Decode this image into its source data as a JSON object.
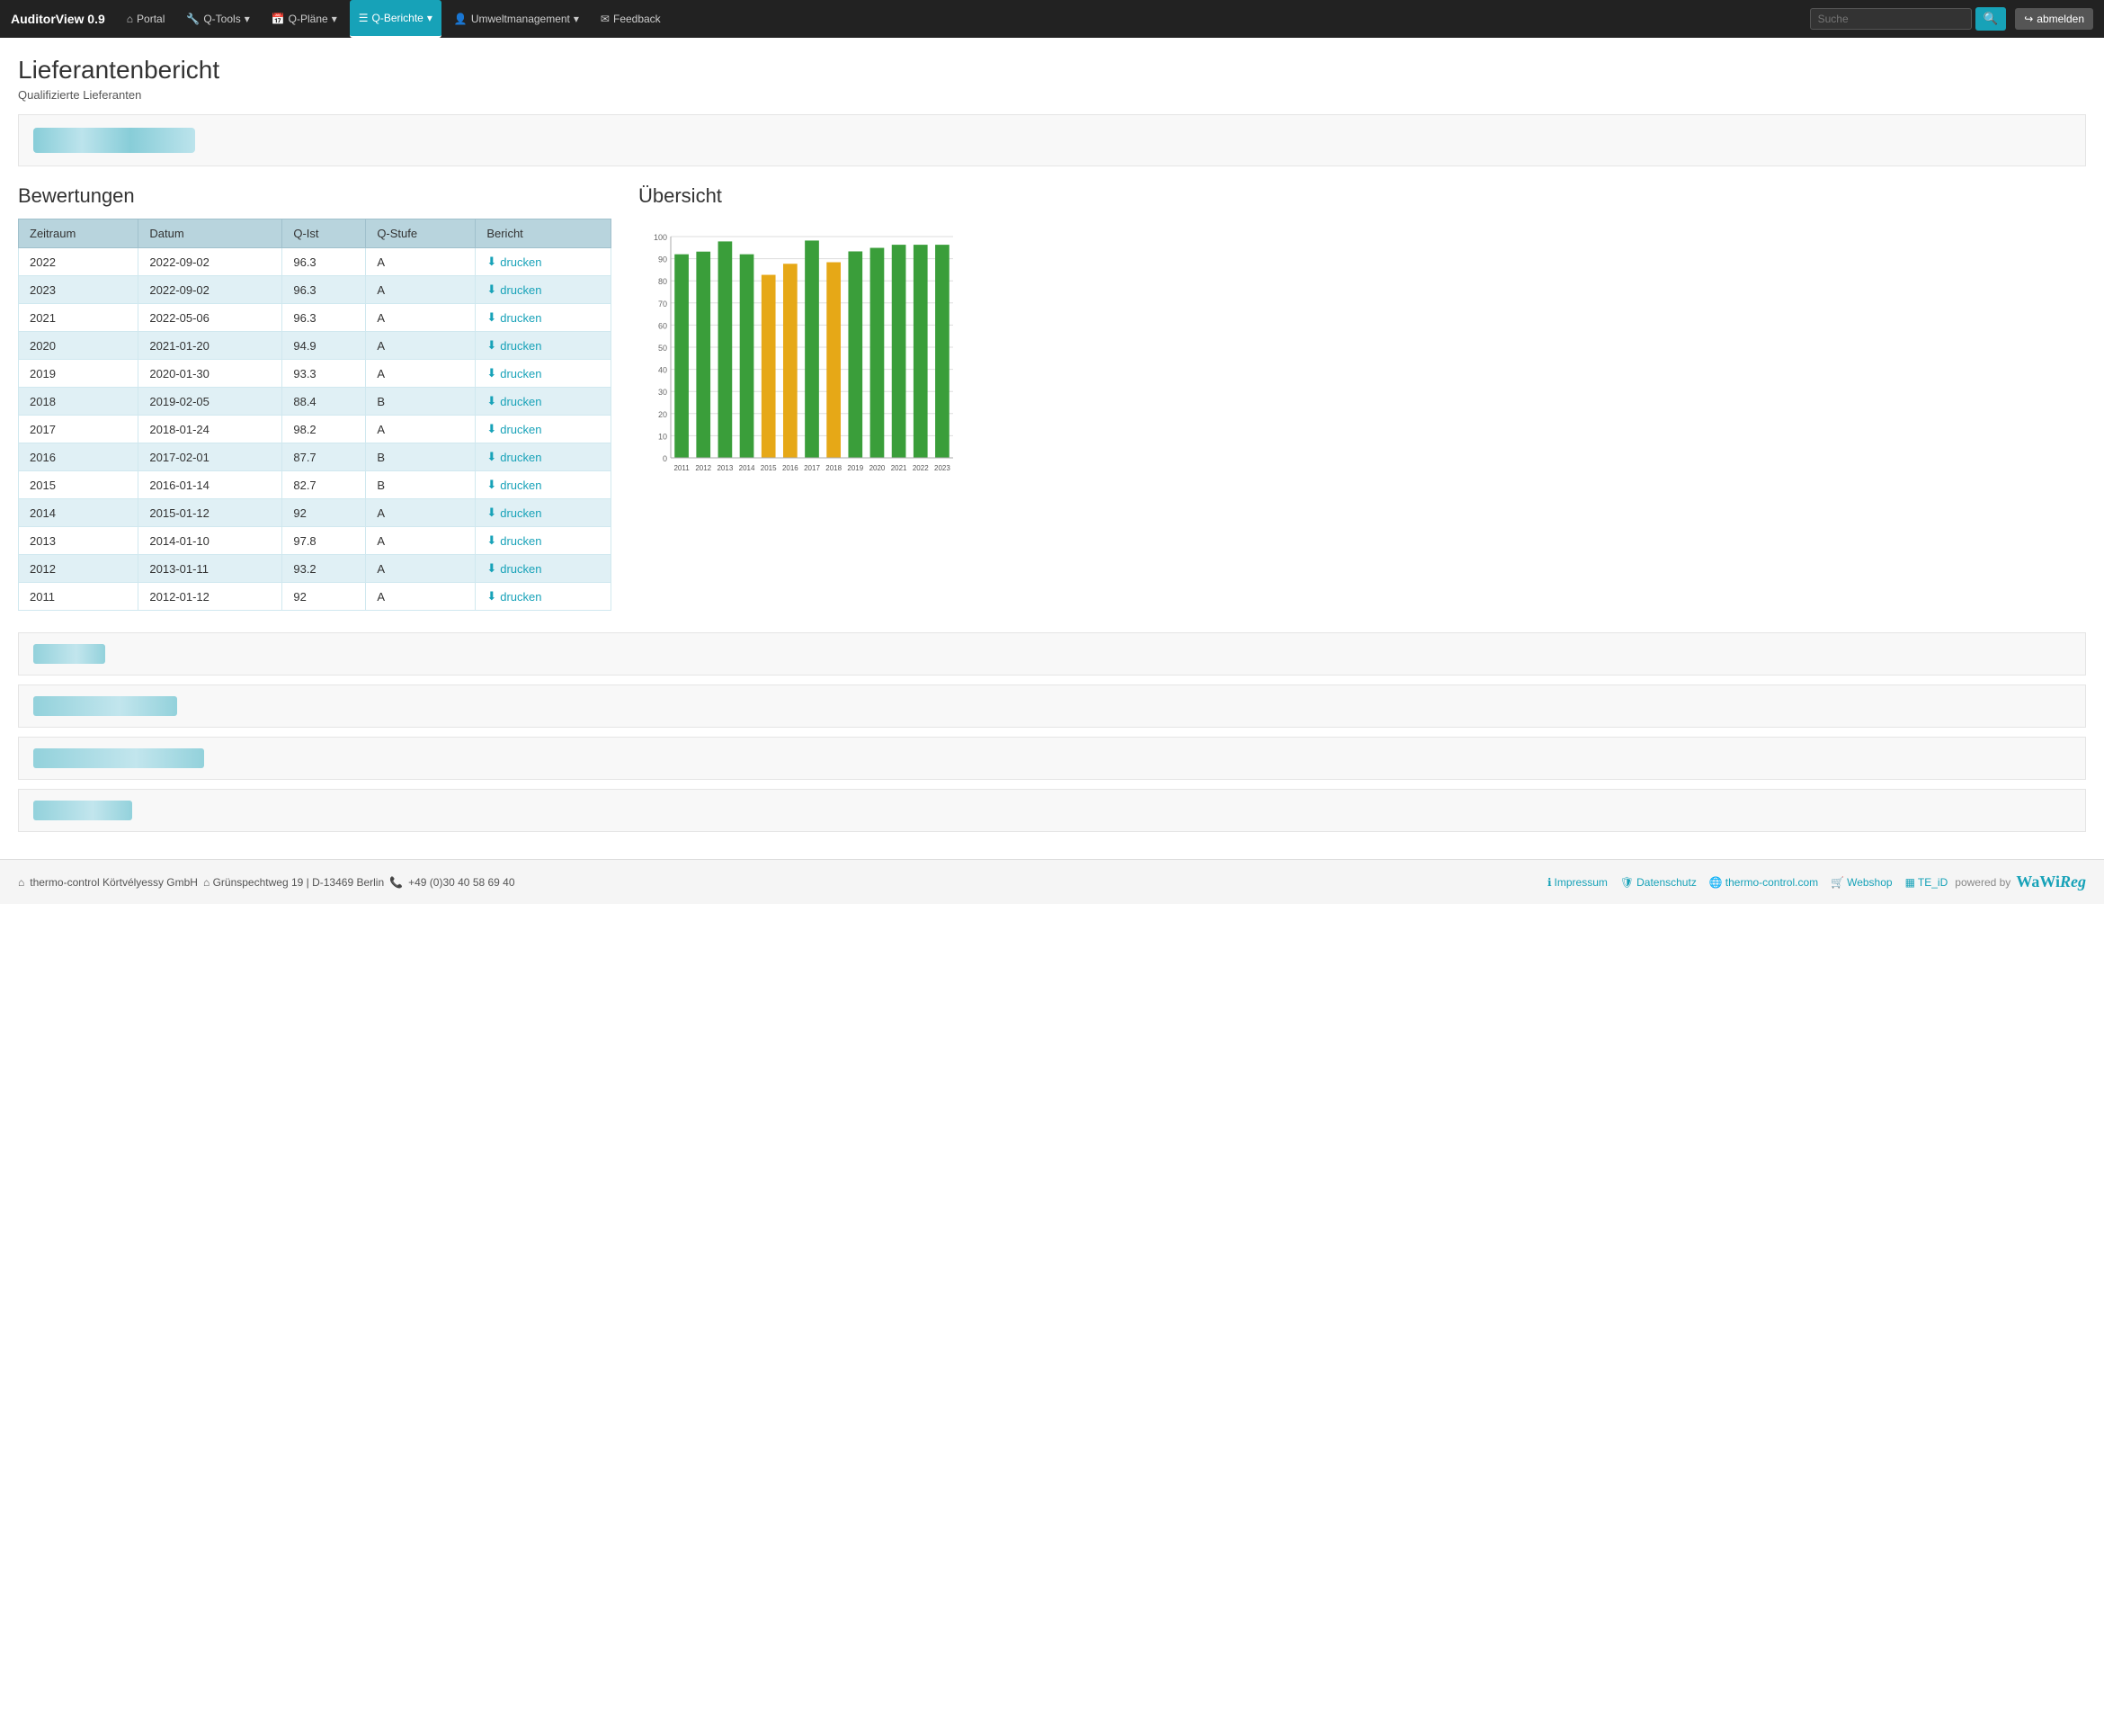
{
  "app": {
    "name": "AuditorView 0.9"
  },
  "navbar": {
    "brand": "AuditorView 0.9",
    "items": [
      {
        "label": "Portal",
        "icon": "home",
        "active": false
      },
      {
        "label": "Q-Tools",
        "icon": "wrench",
        "dropdown": true,
        "active": false
      },
      {
        "label": "Q-Pläne",
        "icon": "calendar",
        "dropdown": true,
        "active": false
      },
      {
        "label": "Q-Berichte",
        "icon": "list",
        "dropdown": true,
        "active": true
      },
      {
        "label": "Umweltmanagement",
        "icon": "user",
        "dropdown": true,
        "active": false
      },
      {
        "label": "Feedback",
        "icon": "envelope",
        "active": false
      }
    ],
    "search_placeholder": "Suche",
    "logout_label": "abmelden"
  },
  "page": {
    "title": "Lieferantenbericht",
    "subtitle": "Qualifizierte Lieferanten"
  },
  "table": {
    "title": "Bewertungen",
    "headers": [
      "Zeitraum",
      "Datum",
      "Q-Ist",
      "Q-Stufe",
      "Bericht"
    ],
    "rows": [
      {
        "zeitraum": "2022",
        "datum": "2022-09-02",
        "q_ist": "96.3",
        "q_stufe": "A",
        "bericht": "drucken"
      },
      {
        "zeitraum": "2023",
        "datum": "2022-09-02",
        "q_ist": "96.3",
        "q_stufe": "A",
        "bericht": "drucken"
      },
      {
        "zeitraum": "2021",
        "datum": "2022-05-06",
        "q_ist": "96.3",
        "q_stufe": "A",
        "bericht": "drucken"
      },
      {
        "zeitraum": "2020",
        "datum": "2021-01-20",
        "q_ist": "94.9",
        "q_stufe": "A",
        "bericht": "drucken"
      },
      {
        "zeitraum": "2019",
        "datum": "2020-01-30",
        "q_ist": "93.3",
        "q_stufe": "A",
        "bericht": "drucken"
      },
      {
        "zeitraum": "2018",
        "datum": "2019-02-05",
        "q_ist": "88.4",
        "q_stufe": "B",
        "bericht": "drucken"
      },
      {
        "zeitraum": "2017",
        "datum": "2018-01-24",
        "q_ist": "98.2",
        "q_stufe": "A",
        "bericht": "drucken"
      },
      {
        "zeitraum": "2016",
        "datum": "2017-02-01",
        "q_ist": "87.7",
        "q_stufe": "B",
        "bericht": "drucken"
      },
      {
        "zeitraum": "2015",
        "datum": "2016-01-14",
        "q_ist": "82.7",
        "q_stufe": "B",
        "bericht": "drucken"
      },
      {
        "zeitraum": "2014",
        "datum": "2015-01-12",
        "q_ist": "92",
        "q_stufe": "A",
        "bericht": "drucken"
      },
      {
        "zeitraum": "2013",
        "datum": "2014-01-10",
        "q_ist": "97.8",
        "q_stufe": "A",
        "bericht": "drucken"
      },
      {
        "zeitraum": "2012",
        "datum": "2013-01-11",
        "q_ist": "93.2",
        "q_stufe": "A",
        "bericht": "drucken"
      },
      {
        "zeitraum": "2011",
        "datum": "2012-01-12",
        "q_ist": "92",
        "q_stufe": "A",
        "bericht": "drucken"
      }
    ]
  },
  "chart": {
    "title": "Übersicht",
    "y_max": 100,
    "y_labels": [
      "100",
      "90",
      "80",
      "70",
      "60",
      "50",
      "40",
      "30",
      "20",
      "10",
      "0"
    ],
    "bars": [
      {
        "year": "2011",
        "value": 92,
        "color": "green"
      },
      {
        "year": "2012",
        "value": 93.2,
        "color": "green"
      },
      {
        "year": "2013",
        "value": 97.8,
        "color": "green"
      },
      {
        "year": "2014",
        "value": 92,
        "color": "green"
      },
      {
        "year": "2015",
        "value": 82.7,
        "color": "orange"
      },
      {
        "year": "2016",
        "value": 87.7,
        "color": "orange"
      },
      {
        "year": "2017",
        "value": 98.2,
        "color": "green"
      },
      {
        "year": "2018",
        "value": 88.4,
        "color": "orange"
      },
      {
        "year": "2019",
        "value": 93.3,
        "color": "green"
      },
      {
        "year": "2020",
        "value": 94.9,
        "color": "green"
      },
      {
        "year": "2021",
        "value": 96.3,
        "color": "green"
      },
      {
        "year": "2022",
        "value": 96.3,
        "color": "green"
      },
      {
        "year": "2023",
        "value": 96.3,
        "color": "green"
      }
    ]
  },
  "footer": {
    "company": "thermo-control Körtvélyessy GmbH",
    "address": "Grünspechtweg 19 | D-13469 Berlin",
    "phone": "+49 (0)30 40 58 69 40",
    "links": [
      {
        "label": "Impressum",
        "icon": "info"
      },
      {
        "label": "Datenschutz",
        "icon": "shield"
      },
      {
        "label": "thermo-control.com",
        "icon": "globe"
      },
      {
        "label": "Webshop",
        "icon": "cart"
      },
      {
        "label": "TE_iD",
        "icon": "barcode"
      }
    ],
    "powered_by": "powered by",
    "brand_name": "WaWiReg"
  }
}
